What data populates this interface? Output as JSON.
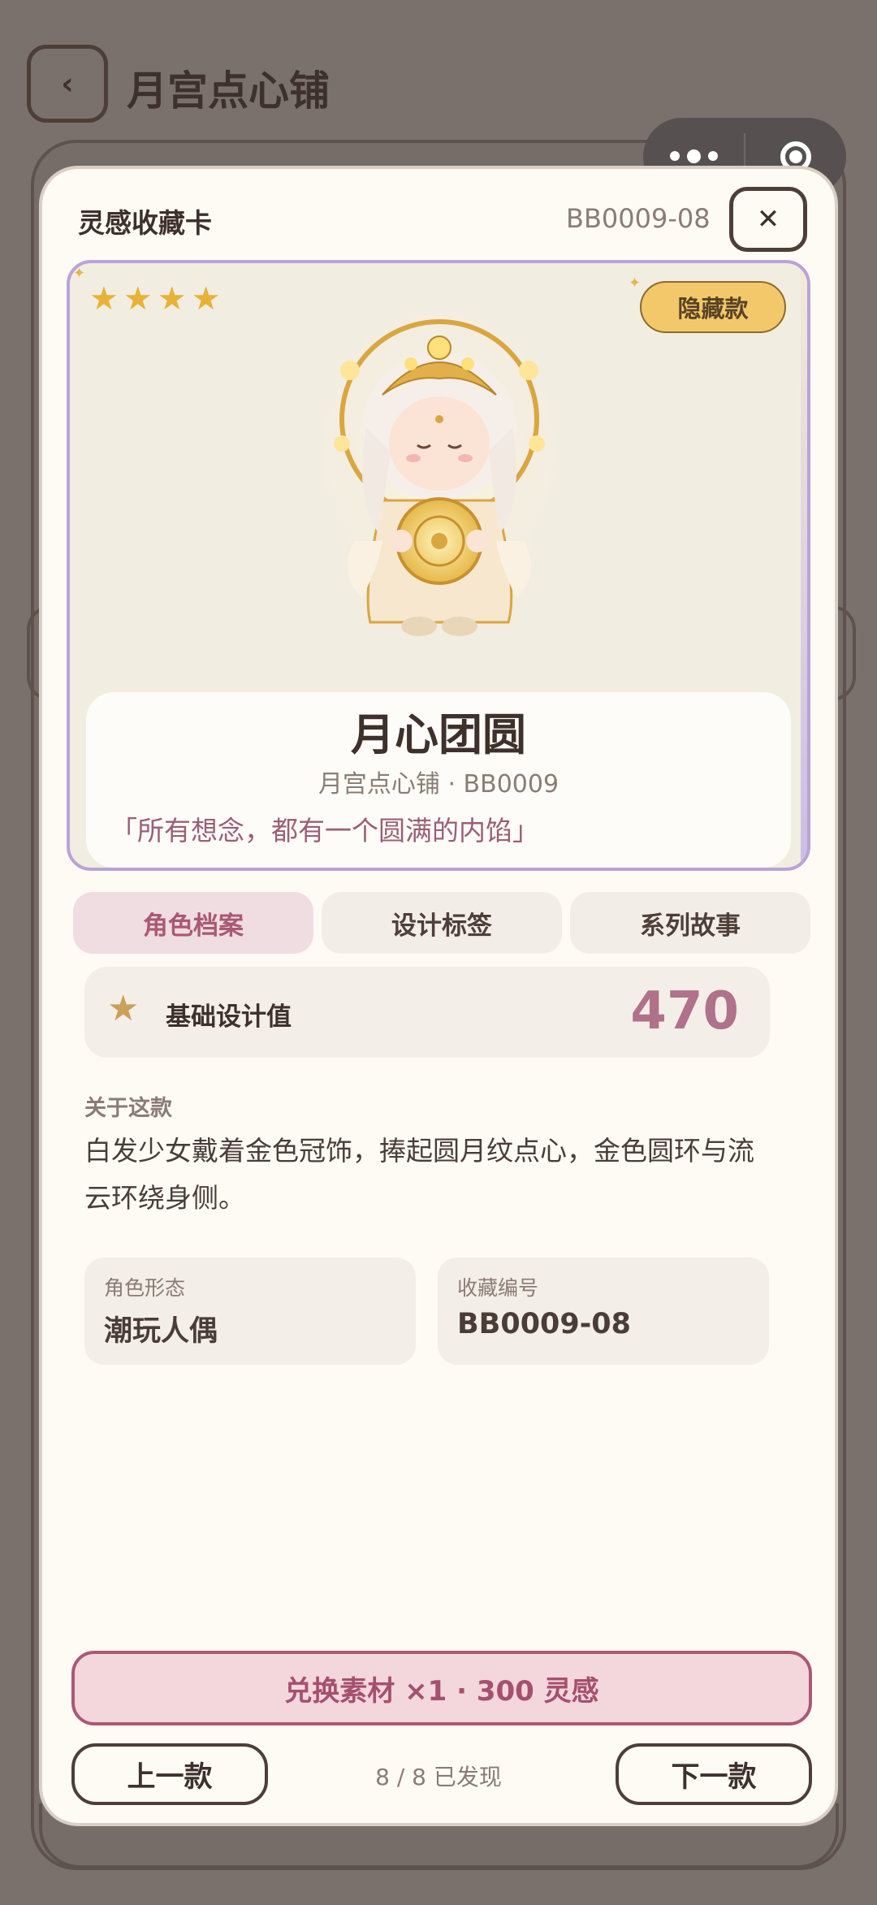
{
  "app": {
    "title": "月宫点心铺"
  },
  "modal": {
    "title": "灵感收藏卡",
    "code": "BB0009-08",
    "close_label": "✕",
    "rarity_stars": 4,
    "badge": "隐藏款",
    "character": {
      "name": "月心团圆",
      "subtitle": "月宫点心铺 · BB0009",
      "quote": "「所有想念，都有一个圆满的内馅」"
    },
    "tabs": [
      {
        "label": "角色档案",
        "active": true
      },
      {
        "label": "设计标签",
        "active": false
      },
      {
        "label": "系列故事",
        "active": false
      }
    ],
    "base_value": {
      "label": "基础设计值",
      "value": "470"
    },
    "about": {
      "heading": "关于这款",
      "text": "白发少女戴着金色冠饰，捧起圆月纹点心，金色圆环与流云环绕身侧。"
    },
    "info": [
      {
        "key": "角色形态",
        "value": "潮玩人偶"
      },
      {
        "key": "收藏编号",
        "value": "BB0009-08"
      }
    ],
    "redeem_label": "兑换素材 ×1 · 300 灵感",
    "prev_label": "上一款",
    "next_label": "下一款",
    "progress": "8 / 8 已发现"
  },
  "icons": {
    "back": "chevron-left-icon",
    "close": "close-icon",
    "star": "star-icon",
    "capsule_more": "more-dots-icon",
    "capsule_close": "target-icon"
  },
  "colors": {
    "accent": "#a95975",
    "gold": "#e7b237",
    "badge": "#f3c86a",
    "card": "#fefbf5"
  }
}
